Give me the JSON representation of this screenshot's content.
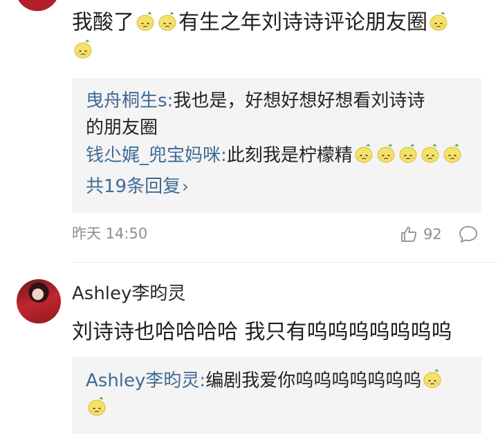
{
  "comment1": {
    "text_line1": "我酸了",
    "text_mid": "有生之年刘诗诗评论朋友圈",
    "replies": [
      {
        "user": "曳舟桐生s",
        "sep": ":",
        "text_line1": "我也是，好想好想好想看刘诗诗",
        "text_line2": "的朋友圈"
      },
      {
        "user": "钱尐娓_兜宝妈咪",
        "sep": ":",
        "text": "此刻我是柠檬精"
      }
    ],
    "more_replies": "共19条回复",
    "time": "昨天 14:50",
    "likes": "92"
  },
  "comment2": {
    "username": "Ashley李昀灵",
    "text": "刘诗诗也哈哈哈哈 我只有呜呜呜呜呜呜呜",
    "reply": {
      "user": "Ashley李昀灵",
      "sep": ":",
      "text": "编剧我爱你呜呜呜呜呜呜呜"
    }
  },
  "icons": {
    "emoji": "lemon-emoji",
    "like": "thumbs-up-icon",
    "comment": "comment-bubble-icon",
    "more": "chevron-right-icon"
  },
  "colors": {
    "link": "#3f6a95",
    "meta": "#8d8d8d",
    "reply_bg": "#f4f4f4",
    "lemon": "#f5e26a"
  }
}
